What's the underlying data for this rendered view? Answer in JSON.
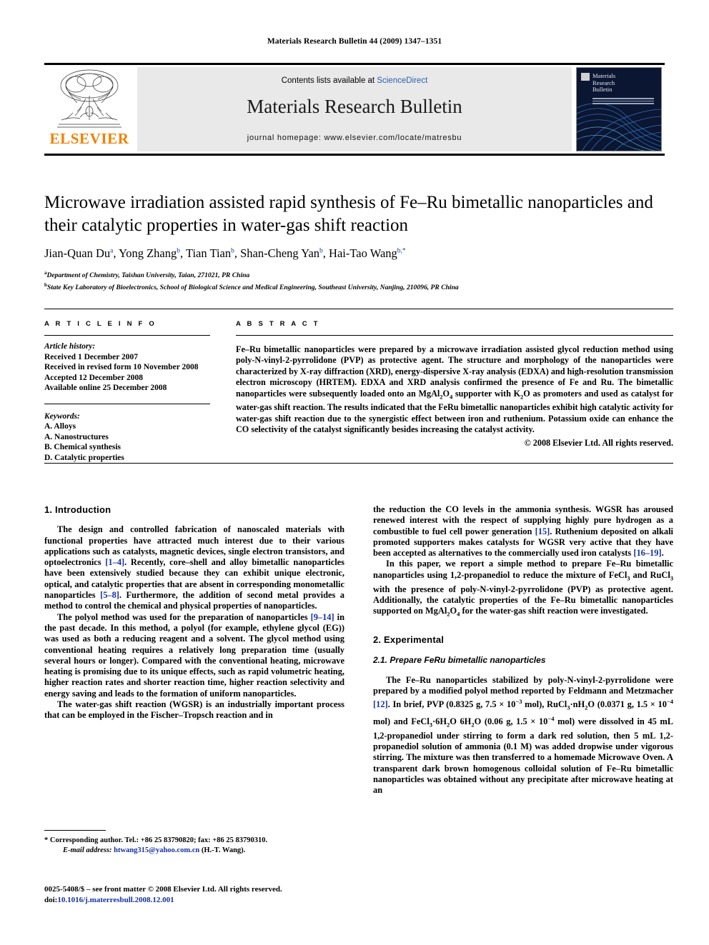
{
  "running_head": "Materials Research Bulletin 44 (2009) 1347–1351",
  "banner": {
    "contents_prefix": "Contents lists available at ",
    "sciencedirect": "ScienceDirect",
    "journal_title": "Materials Research Bulletin",
    "homepage": "journal homepage: www.elsevier.com/locate/matresbu",
    "publisher": "ELSEVIER",
    "publisher_color": "#F08000",
    "link_color": "#2a5db0",
    "cover_title_line1": "Materials",
    "cover_title_line2": "Research",
    "cover_title_line3": "Bulletin"
  },
  "article": {
    "title": "Microwave irradiation assisted rapid synthesis of Fe–Ru bimetallic nanoparticles and their catalytic properties in water-gas shift reaction",
    "authors": [
      {
        "name": "Jian-Quan Du",
        "marks": "a",
        "sep": ", "
      },
      {
        "name": "Yong Zhang",
        "marks": "b",
        "sep": ", "
      },
      {
        "name": "Tian Tian",
        "marks": "b",
        "sep": ", "
      },
      {
        "name": "Shan-Cheng Yan",
        "marks": "b",
        "sep": ", "
      },
      {
        "name": "Hai-Tao Wang",
        "marks": "b,*",
        "sep": ""
      }
    ],
    "affiliations": [
      {
        "mark": "a",
        "text": "Department of Chemistry, Taishan University, Taian, 271021, PR China"
      },
      {
        "mark": "b",
        "text": "State Key Laboratory of Bioelectronics, School of Biological Science and Medical Engineering, Southeast University, Nanjing, 210096, PR China"
      }
    ]
  },
  "article_info": {
    "heading": "A R T I C L E  I N F O",
    "history_label": "Article history:",
    "history": [
      "Received 1 December 2007",
      "Received in revised form 10 November 2008",
      "Accepted 12 December 2008",
      "Available online 25 December 2008"
    ],
    "keywords_label": "Keywords:",
    "keywords": [
      "A. Alloys",
      "A. Nanostructures",
      "B. Chemical synthesis",
      "D. Catalytic properties"
    ]
  },
  "abstract": {
    "heading": "A B S T R A C T",
    "text": "Fe–Ru bimetallic nanoparticles were prepared by a microwave irradiation assisted glycol reduction method using poly-N-vinyl-2-pyrrolidone (PVP) as protective agent. The structure and morphology of the nanoparticles were characterized by X-ray diffraction (XRD), energy-dispersive X-ray analysis (EDXA) and high-resolution transmission electron microscopy (HRTEM). EDXA and XRD analysis confirmed the presence of Fe and Ru. The bimetallic nanoparticles were subsequently loaded onto an MgAl2O4 supporter with K2O as promoters and used as catalyst for water-gas shift reaction. The results indicated that the FeRu bimetallic nanoparticles exhibit high catalytic activity for water-gas shift reaction due to the synergistic effect between iron and ruthenium. Potassium oxide can enhance the CO selectivity of the catalyst significantly besides increasing the catalyst activity.",
    "copyright": "© 2008 Elsevier Ltd. All rights reserved."
  },
  "body": {
    "section1_title": "1. Introduction",
    "left_paragraphs": [
      "The design and controlled fabrication of nanoscaled materials with functional properties have attracted much interest due to their various applications such as catalysts, magnetic devices, single electron transistors, and optoelectronics [1–4]. Recently, core–shell and alloy bimetallic nanoparticles have been extensively studied because they can exhibit unique electronic, optical, and catalytic properties that are absent in corresponding monometallic nanoparticles [5–8]. Furthermore, the addition of second metal provides a method to control the chemical and physical properties of nanoparticles.",
      "The polyol method was used for the preparation of nanoparticles [9–14] in the past decade. In this method, a polyol (for example, ethylene glycol (EG)) was used as both a reducing reagent and a solvent. The glycol method using conventional heating requires a relatively long preparation time (usually several hours or longer). Compared with the conventional heating, microwave heating is promising due to its unique effects, such as rapid volumetric heating, higher reaction rates and shorter reaction time, higher reaction selectivity and energy saving and leads to the formation of uniform nanoparticles.",
      "The water-gas shift reaction (WGSR) is an industrially important process that can be employed in the Fischer–Tropsch reaction and in"
    ],
    "right_paragraph_1": "the reduction the CO levels in the ammonia synthesis. WGSR has aroused renewed interest with the respect of supplying highly pure hydrogen as a combustible to fuel cell power generation [15]. Ruthenium deposited on alkali promoted supporters makes catalysts for WGSR very active that they have been accepted as alternatives to the commercially used iron catalysts [16–19].",
    "right_paragraph_2": "In this paper, we report a simple method to prepare Fe–Ru bimetallic nanoparticles using 1,2-propanediol to reduce the mixture of FeCl3 and RuCl3 with the presence of poly-N-vinyl-2-pyrrolidone (PVP) as protective agent. Additionally, the catalytic properties of the Fe–Ru bimetallic nanoparticles supported on MgAl2O4 for the water-gas shift reaction were investigated.",
    "section2_title": "2. Experimental",
    "section21_title": "2.1. Prepare FeRu bimetallic nanoparticles",
    "right_paragraph_3": "The Fe–Ru nanoparticles stabilized by poly-N-vinyl-2-pyrrolidone were prepared by a modified polyol method reported by Feldmann and Metzmacher [12]. In brief, PVP (0.8325 g, 7.5 × 10−3 mol), RuCl3·nH2O (0.0371 g, 1.5 × 10−4 mol) and FeCl3·6H2O 6H2O (0.06 g, 1.5 × 10−4 mol) were dissolved in 45 mL 1,2-propanediol under stirring to form a dark red solution, then 5 mL 1,2-propanediol solution of ammonia (0.1 M) was added dropwise under vigorous stirring. The mixture was then transferred to a homemade Microwave Oven. A transparent dark brown homogenous colloidal solution of Fe–Ru bimetallic nanoparticles was obtained without any precipitate after microwave heating at an"
  },
  "footnotes": {
    "corresponding": "* Corresponding author. Tel.: +86 25 83790820; fax: +86 25 83790310.",
    "email_label": "E-mail address:",
    "email": "htwang315@yahoo.com.cn",
    "email_owner": "(H.-T. Wang).",
    "imprint": "0025-5408/$ – see front matter © 2008 Elsevier Ltd. All rights reserved.",
    "doi_label": "doi:",
    "doi": "10.1016/j.materresbull.2008.12.001"
  }
}
